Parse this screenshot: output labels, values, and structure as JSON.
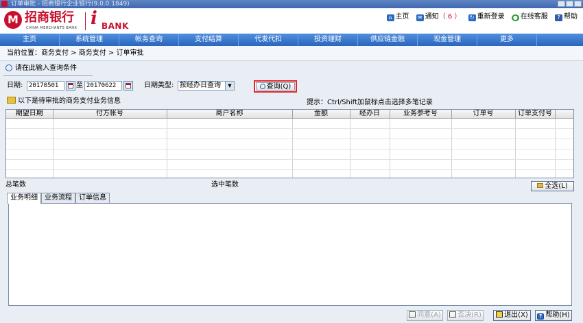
{
  "window": {
    "title": "订单审批 - 招商银行企业银行(9.0.0.1849)"
  },
  "header": {
    "logo_cn": "招商银行",
    "logo_en": "CHINA MERCHANTS BANK",
    "logo_mark": "M",
    "ibank_i": "i",
    "ibank_text": "BANK",
    "links": {
      "home": "主页",
      "notify": "通知",
      "notify_count": "（ 6 ）",
      "relogin": "重新登录",
      "service": "在线客服",
      "help": "帮助"
    }
  },
  "nav": [
    "主页",
    "系统管理",
    "帐务查询",
    "支付结算",
    "代发代扣",
    "投资理财",
    "供应链金融",
    "现金管理",
    "更多"
  ],
  "breadcrumb": "当前位置：商务支付 > 商务支付 > 订单审批",
  "query": {
    "header": "请在此输入查询条件",
    "date_label": "日期:",
    "start_date": "20170501",
    "to_label": "至",
    "end_date": "20170622",
    "date_type_label": "日期类型:",
    "date_type_value": "按经办日查询",
    "query_button": "查询(Q)"
  },
  "list_title": "以下是待审批的商务支付业务信息",
  "hint": "提示：Ctrl/Shift加鼠标点击选择多笔记录",
  "table": {
    "columns": [
      "期望日期",
      "付方帐号",
      "商户名称",
      "金额",
      "经办日",
      "业务参考号",
      "订单号",
      "订单支付号"
    ]
  },
  "summary": {
    "total_label": "总笔数",
    "selected_label": "选中笔数",
    "select_all": "全选(L)"
  },
  "tabs": [
    "业务明细",
    "业务流程",
    "订单信息"
  ],
  "buttons": {
    "approve": "同意(A)",
    "reject": "否决(R)",
    "exit": "退出(X)",
    "help": "帮助(H)"
  },
  "colors": {
    "brand_red": "#c8102e",
    "nav_blue": "#2a66bd",
    "highlight": "#e0262f"
  },
  "icons": [
    "home-icon",
    "notify-icon",
    "relogin-icon",
    "service-icon",
    "help-icon",
    "search-icon",
    "calendar-icon",
    "folder-icon",
    "dropdown-arrow-icon"
  ]
}
